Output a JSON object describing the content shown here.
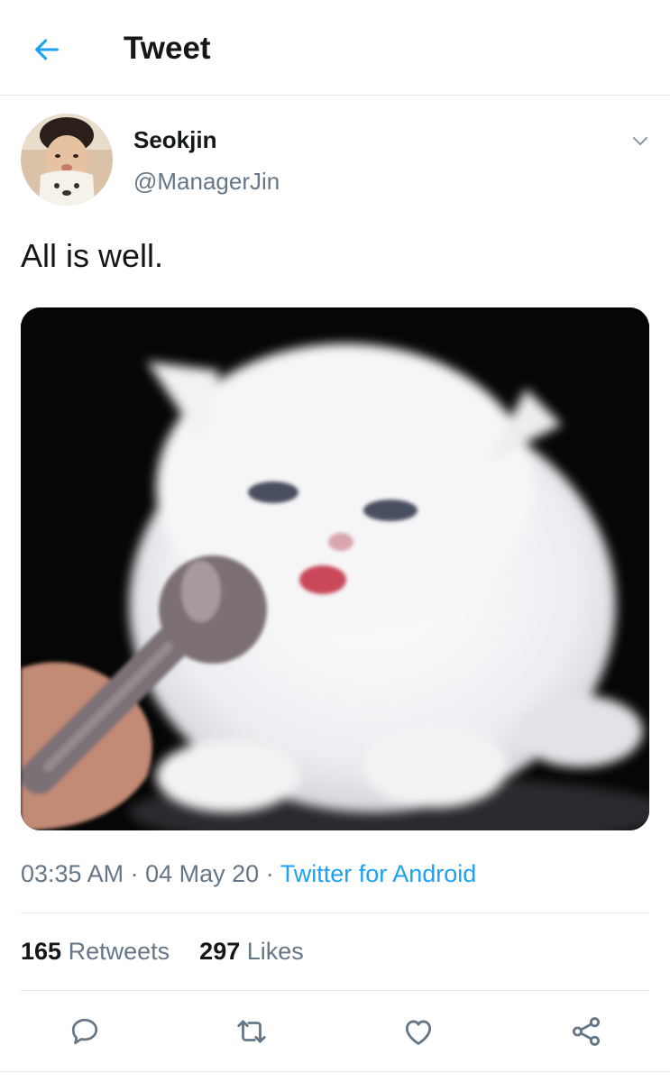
{
  "header": {
    "title": "Tweet",
    "back_icon": "arrow-left-icon",
    "accent_color": "#1da1f2"
  },
  "tweet": {
    "display_name": "Seokjin",
    "handle": "@ManagerJin",
    "text": "All is well.",
    "time": "03:35 AM",
    "date": "04 May 20",
    "separator": "·",
    "source": "Twitter for Android",
    "stats": {
      "retweets_count": "165",
      "retweets_label": "Retweets",
      "likes_count": "297",
      "likes_label": "Likes"
    }
  },
  "actions": [
    {
      "name": "reply",
      "icon": "comment-icon"
    },
    {
      "name": "retweet",
      "icon": "retweet-icon"
    },
    {
      "name": "like",
      "icon": "heart-icon"
    },
    {
      "name": "share",
      "icon": "share-icon"
    }
  ],
  "colors": {
    "text_primary": "#14171a",
    "text_secondary": "#657786",
    "link": "#1da1f2",
    "divider": "#e1e8ed"
  }
}
